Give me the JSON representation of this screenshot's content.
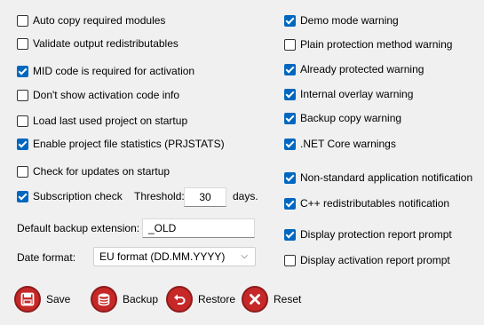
{
  "left_options": [
    {
      "label": "Auto copy required modules",
      "checked": false
    },
    {
      "label": "Validate output redistributables",
      "checked": false
    },
    {
      "label": "MID code is required for activation",
      "checked": true
    },
    {
      "label": "Don't show activation code info",
      "checked": false
    },
    {
      "label": "Load last used project on startup",
      "checked": false
    },
    {
      "label": "Enable project file statistics (PRJSTATS)",
      "checked": true
    },
    {
      "label": "Check for updates on startup",
      "checked": false
    },
    {
      "label": "Subscription check",
      "checked": true
    }
  ],
  "right_options": [
    {
      "label": "Demo mode warning",
      "checked": true
    },
    {
      "label": "Plain protection method warning",
      "checked": false
    },
    {
      "label": "Already protected warning",
      "checked": true
    },
    {
      "label": "Internal overlay warning",
      "checked": true
    },
    {
      "label": "Backup copy warning",
      "checked": true
    },
    {
      "label": ".NET Core warnings",
      "checked": true
    },
    {
      "label": "Non-standard application notification",
      "checked": true
    },
    {
      "label": "C++ redistributables notification",
      "checked": true
    },
    {
      "label": "Display protection report prompt",
      "checked": true
    },
    {
      "label": "Display activation report prompt",
      "checked": false
    }
  ],
  "threshold": {
    "label": "Threshold:",
    "value": "30",
    "unit": "days."
  },
  "backup_extension": {
    "label": "Default backup extension:",
    "value": "_OLD"
  },
  "date_format": {
    "label": "Date format:",
    "selected": "EU format (DD.MM.YYYY)"
  },
  "buttons": {
    "save": "Save",
    "backup": "Backup",
    "restore": "Restore",
    "reset": "Reset"
  },
  "colors": {
    "accent": "#0067c0",
    "button_red": "#c62828"
  }
}
